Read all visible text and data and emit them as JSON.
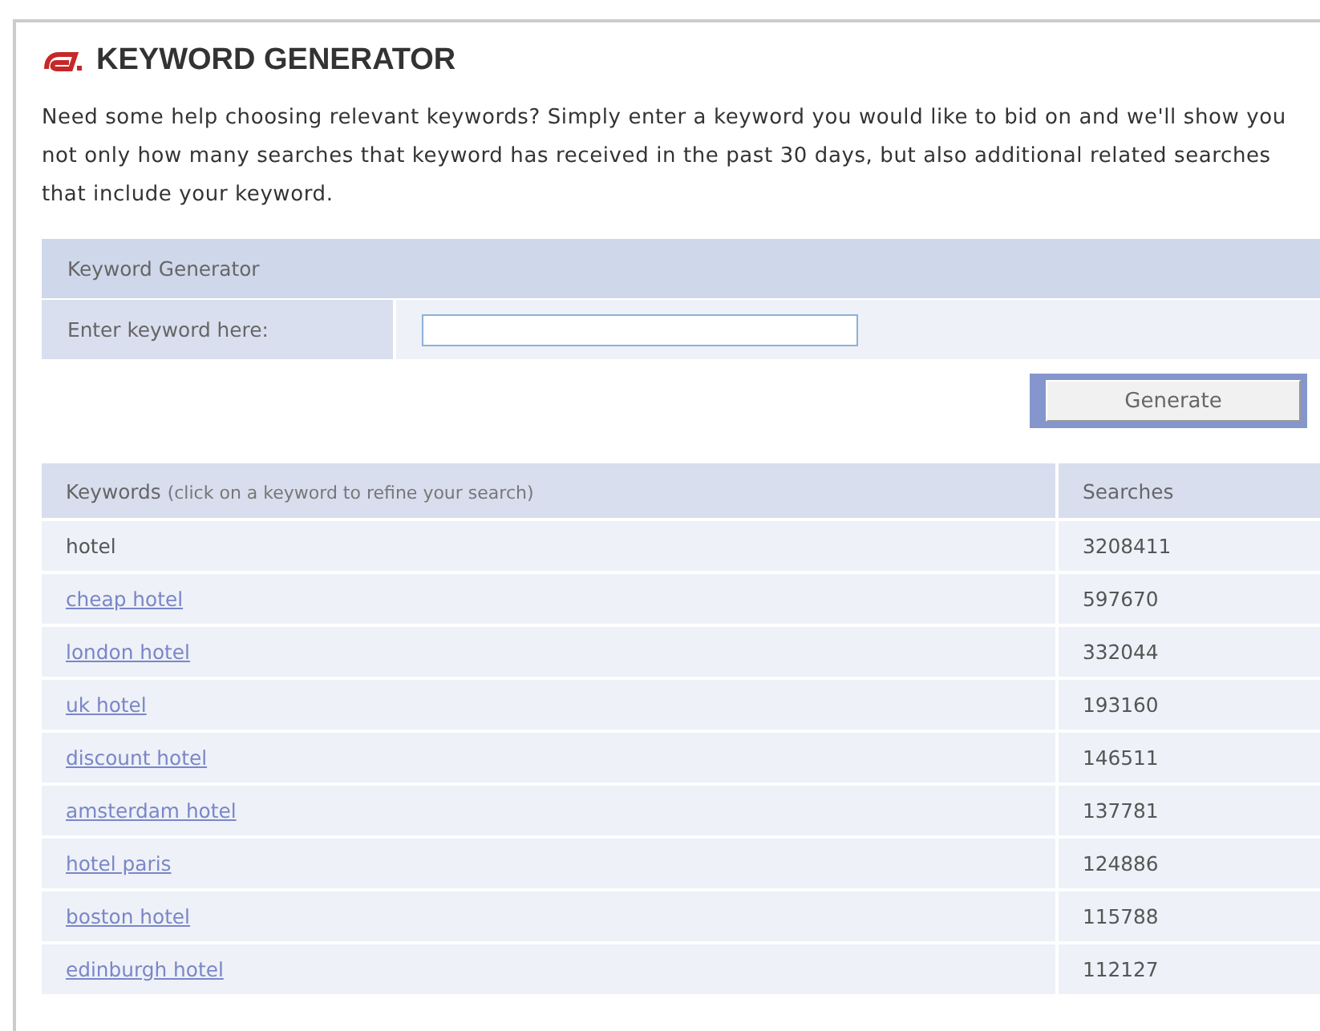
{
  "title": "KEYWORD GENERATOR",
  "intro": "Need some help choosing relevant keywords? Simply enter a keyword you would like to bid on and we'll show you not only how many searches that keyword has received in the past 30 days, but also additional related searches that include your keyword.",
  "form": {
    "heading": "Keyword Generator",
    "label": "Enter keyword here:",
    "button": "Generate"
  },
  "table": {
    "columns": [
      {
        "label": "Keywords",
        "hint": "(click on a keyword to refine your search)"
      },
      {
        "label": "Searches"
      }
    ],
    "rows": [
      {
        "keyword": "hotel",
        "link": false,
        "searches": "3208411"
      },
      {
        "keyword": "cheap hotel",
        "link": true,
        "searches": "597670"
      },
      {
        "keyword": "london hotel",
        "link": true,
        "searches": "332044"
      },
      {
        "keyword": "uk hotel",
        "link": true,
        "searches": "193160"
      },
      {
        "keyword": "discount hotel",
        "link": true,
        "searches": "146511"
      },
      {
        "keyword": "amsterdam hotel",
        "link": true,
        "searches": "137781"
      },
      {
        "keyword": "hotel paris",
        "link": true,
        "searches": "124886"
      },
      {
        "keyword": "boston hotel",
        "link": true,
        "searches": "115788"
      },
      {
        "keyword": "edinburgh hotel",
        "link": true,
        "searches": "112127"
      }
    ]
  }
}
